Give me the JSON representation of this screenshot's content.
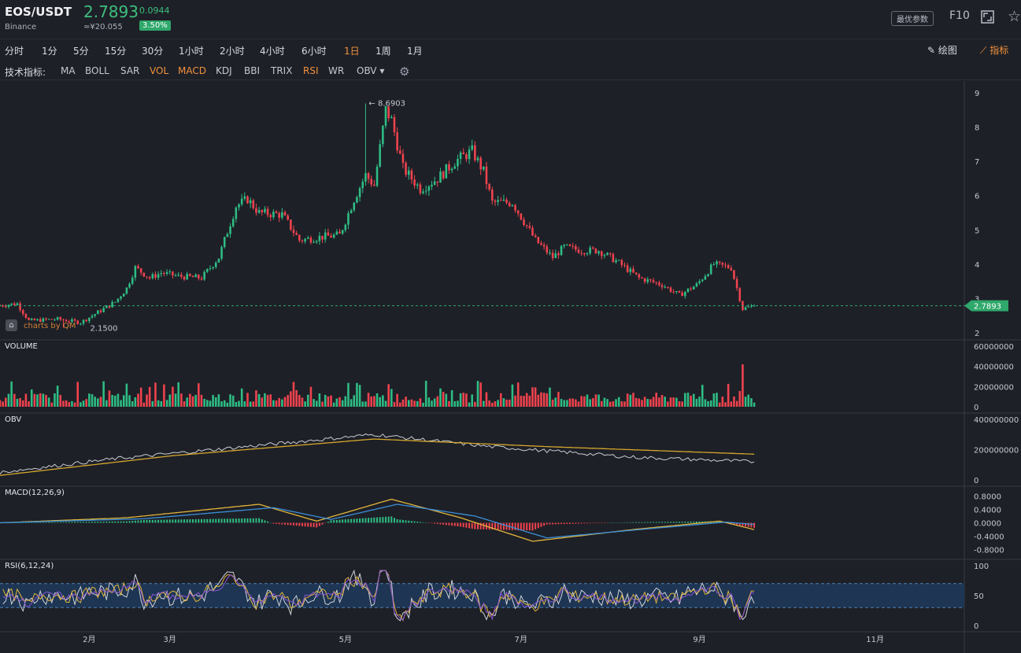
{
  "header": {
    "pair": "EOS/USDT",
    "exchange": "Binance",
    "price": "2.7893",
    "cny": "≈¥20.055",
    "change": "0.0944",
    "change_pct": "3.50%",
    "opt_label": "最优参数",
    "f10_label": "F10"
  },
  "periods": [
    {
      "label": "分时",
      "active": false
    },
    {
      "label": "1分",
      "active": false
    },
    {
      "label": "5分",
      "active": false
    },
    {
      "label": "15分",
      "active": false
    },
    {
      "label": "30分",
      "active": false
    },
    {
      "label": "1小时",
      "active": false
    },
    {
      "label": "2小时",
      "active": false
    },
    {
      "label": "4小时",
      "active": false
    },
    {
      "label": "6小时",
      "active": false
    },
    {
      "label": "1日",
      "active": true
    },
    {
      "label": "1周",
      "active": false
    },
    {
      "label": "1月",
      "active": false
    }
  ],
  "toolbar": {
    "draw_label": "绘图",
    "indicator_label": "指标"
  },
  "indicator_bar": {
    "label": "技术指标:",
    "items": [
      {
        "label": "MA",
        "active": false
      },
      {
        "label": "BOLL",
        "active": false
      },
      {
        "label": "SAR",
        "active": false
      },
      {
        "label": "VOL",
        "active": true
      },
      {
        "label": "MACD",
        "active": true
      },
      {
        "label": "KDJ",
        "active": false
      },
      {
        "label": "BBI",
        "active": false
      },
      {
        "label": "TRIX",
        "active": false
      },
      {
        "label": "RSI",
        "active": true
      },
      {
        "label": "WR",
        "active": false
      },
      {
        "label": "OBV ▾",
        "active": false
      }
    ]
  },
  "panels": {
    "volume": "VOLUME",
    "obv": "OBV",
    "macd": "MACD(12,26,9)",
    "rsi": "RSI(6,12,24)"
  },
  "watermark": "charts by QM",
  "colors": {
    "up": "#2ebd85",
    "down": "#f0434e",
    "accent": "#f0923b",
    "bg": "#1e2027",
    "price_tag": "#2fa86b"
  },
  "chart_data": {
    "type": "candlestick",
    "price_axis": {
      "ticks": [
        "9",
        "8",
        "7",
        "6",
        "5",
        "4",
        "3",
        "2"
      ],
      "ylim": [
        2,
        9
      ]
    },
    "x_ticks": [
      "2月",
      "3月",
      "5月",
      "7月",
      "9月",
      "11月"
    ],
    "x_tick_days": [
      31,
      59,
      120,
      181,
      243,
      304
    ],
    "x_range_days": [
      0,
      335
    ],
    "last_price": "2.7893",
    "high_annotation": {
      "label": "8.6903",
      "value": 8.6903,
      "day": 127
    },
    "low_annotation": {
      "label": "2.1500",
      "value": 2.15,
      "day": 22
    },
    "price_path": [
      [
        0,
        2.8
      ],
      [
        6,
        2.85
      ],
      [
        10,
        2.35
      ],
      [
        20,
        2.4
      ],
      [
        28,
        2.3
      ],
      [
        34,
        2.6
      ],
      [
        40,
        2.9
      ],
      [
        44,
        3.3
      ],
      [
        47,
        3.9
      ],
      [
        52,
        3.6
      ],
      [
        56,
        3.75
      ],
      [
        62,
        3.65
      ],
      [
        70,
        3.6
      ],
      [
        76,
        4.2
      ],
      [
        82,
        5.7
      ],
      [
        86,
        5.9
      ],
      [
        90,
        5.5
      ],
      [
        98,
        5.45
      ],
      [
        104,
        4.7
      ],
      [
        112,
        4.8
      ],
      [
        118,
        4.85
      ],
      [
        123,
        5.9
      ],
      [
        127,
        6.6
      ],
      [
        130,
        6.3
      ],
      [
        134,
        8.5
      ],
      [
        136,
        8.2
      ],
      [
        140,
        6.8
      ],
      [
        146,
        6.2
      ],
      [
        152,
        6.5
      ],
      [
        158,
        7.0
      ],
      [
        164,
        7.3
      ],
      [
        168,
        6.7
      ],
      [
        171,
        5.8
      ],
      [
        178,
        5.8
      ],
      [
        186,
        4.7
      ],
      [
        192,
        4.2
      ],
      [
        196,
        4.5
      ],
      [
        202,
        4.4
      ],
      [
        208,
        4.4
      ],
      [
        214,
        4.1
      ],
      [
        222,
        3.6
      ],
      [
        230,
        3.4
      ],
      [
        236,
        3.1
      ],
      [
        242,
        3.4
      ],
      [
        248,
        4.0
      ],
      [
        254,
        3.9
      ],
      [
        258,
        2.7
      ],
      [
        262,
        2.79
      ]
    ],
    "volume_axis": {
      "ticks": [
        "60000000",
        "40000000",
        "20000000",
        "0"
      ],
      "ylim": [
        0,
        60000000
      ]
    },
    "volume_spike": {
      "day": 258,
      "value": 42000000
    },
    "obv_axis": {
      "ticks": [
        "400000000",
        "200000000",
        "0"
      ],
      "ylim": [
        0,
        400000000
      ]
    },
    "obv_path": [
      [
        0,
        50000000
      ],
      [
        40,
        140000000
      ],
      [
        80,
        210000000
      ],
      [
        130,
        300000000
      ],
      [
        170,
        220000000
      ],
      [
        220,
        150000000
      ],
      [
        262,
        120000000
      ]
    ],
    "obv_ma_path": [
      [
        0,
        30000000
      ],
      [
        60,
        160000000
      ],
      [
        130,
        270000000
      ],
      [
        190,
        220000000
      ],
      [
        262,
        170000000
      ]
    ],
    "macd_axis": {
      "ticks": [
        "0.8000",
        "0.4000",
        "0.0000",
        "-0.4000",
        "-0.8000"
      ],
      "ylim": [
        -0.9,
        0.9
      ]
    },
    "macd_dif_path": [
      [
        0,
        0
      ],
      [
        44,
        0.15
      ],
      [
        90,
        0.55
      ],
      [
        110,
        0.05
      ],
      [
        136,
        0.7
      ],
      [
        160,
        0.15
      ],
      [
        185,
        -0.55
      ],
      [
        220,
        -0.2
      ],
      [
        250,
        0.05
      ],
      [
        262,
        -0.2
      ]
    ],
    "macd_dea_path": [
      [
        0,
        0
      ],
      [
        50,
        0.12
      ],
      [
        95,
        0.45
      ],
      [
        115,
        0.1
      ],
      [
        138,
        0.55
      ],
      [
        165,
        0.2
      ],
      [
        190,
        -0.45
      ],
      [
        225,
        -0.18
      ],
      [
        252,
        0.02
      ],
      [
        262,
        -0.05
      ]
    ],
    "rsi_axis": {
      "ticks": [
        "100",
        "50",
        "0"
      ],
      "ylim": [
        0,
        100
      ],
      "bands": [
        70,
        30
      ]
    }
  }
}
